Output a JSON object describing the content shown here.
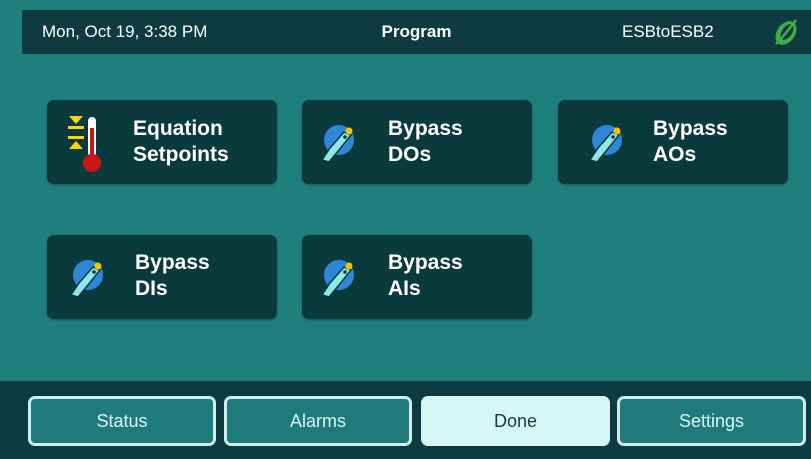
{
  "header": {
    "datetime": "Mon, Oct 19, 3:38 PM",
    "title": "Program",
    "site": "ESBtoESB2",
    "logo_icon": "leaf-logo-icon"
  },
  "tiles": [
    {
      "line1": "Equation",
      "line2": "Setpoints",
      "icon": "thermometer-setpoint-icon"
    },
    {
      "line1": "Bypass",
      "line2": "DOs",
      "icon": "hand-bypass-icon"
    },
    {
      "line1": "Bypass",
      "line2": "AOs",
      "icon": "hand-bypass-icon"
    },
    {
      "line1": "Bypass",
      "line2": "DIs",
      "icon": "hand-bypass-icon"
    },
    {
      "line1": "Bypass",
      "line2": "AIs",
      "icon": "hand-bypass-icon"
    }
  ],
  "nav": {
    "status": "Status",
    "alarms": "Alarms",
    "done": "Done",
    "settings": "Settings",
    "active": "Done"
  },
  "colors": {
    "background": "#1f7f7d",
    "bar": "#0d3b3f",
    "tile": "#0b3a3d",
    "active_button": "#d7f7f6"
  }
}
